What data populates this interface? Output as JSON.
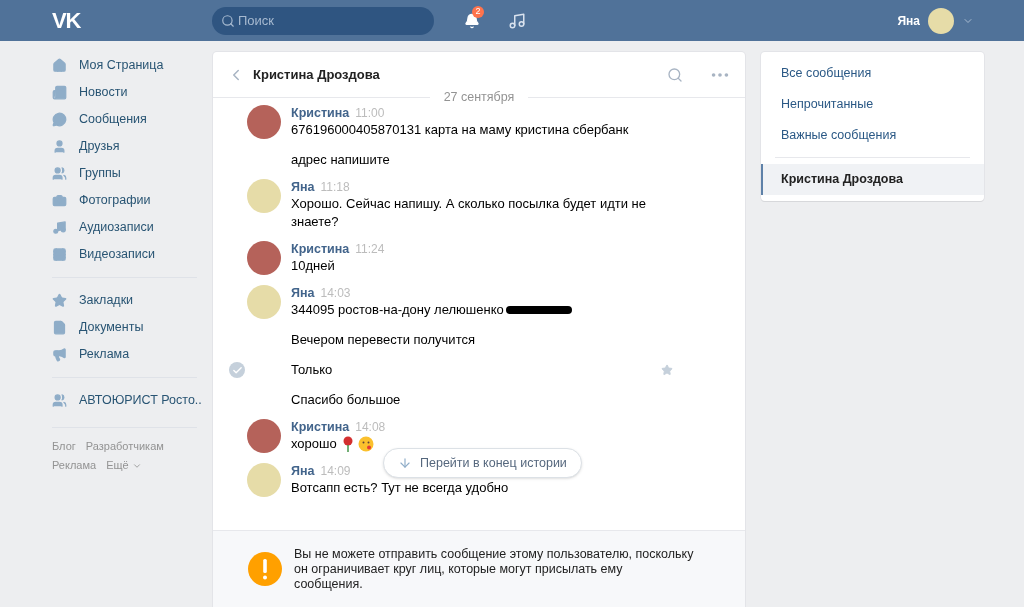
{
  "top_bar": {
    "logo": "VK",
    "search": {
      "placeholder": "Поиск"
    },
    "notifications": {
      "count": "2"
    },
    "user": {
      "name": "Яна"
    }
  },
  "sidebar": {
    "sections": [
      {
        "items": [
          {
            "label": "Моя Страница"
          },
          {
            "label": "Новости"
          },
          {
            "label": "Сообщения"
          },
          {
            "label": "Друзья"
          },
          {
            "label": "Группы"
          },
          {
            "label": "Фотографии"
          },
          {
            "label": "Аудиозаписи"
          },
          {
            "label": "Видеозаписи"
          }
        ]
      },
      {
        "items": [
          {
            "label": "Закладки"
          },
          {
            "label": "Документы"
          },
          {
            "label": "Реклама"
          }
        ]
      },
      {
        "items": [
          {
            "label": "АВТОЮРИСТ Росто.."
          }
        ]
      }
    ],
    "footer_links": [
      "Блог",
      "Разработчикам",
      "Реклама",
      "Ещё"
    ]
  },
  "chat": {
    "title": "Кристина Дроздова",
    "date": "27 сентября",
    "messages": [
      {
        "author": "Кристина",
        "time": "11:00",
        "kind": "contact",
        "lines": [
          {
            "text": "676196000405870131 карта на маму кристина сбербанк",
            "hovered": false,
            "kind": "plain"
          },
          {
            "text": "адрес напишите",
            "hovered": false,
            "kind": "plain"
          }
        ]
      },
      {
        "author": "Яна",
        "time": "11:18",
        "kind": "self",
        "lines": [
          {
            "text": "Хорошо. Сейчас напишу. А сколько посылка будет идти не знаете?",
            "hovered": false,
            "kind": "plain"
          }
        ]
      },
      {
        "author": "Кристина",
        "time": "11:24",
        "kind": "contact",
        "lines": [
          {
            "text": "10дней",
            "hovered": false,
            "kind": "plain"
          }
        ]
      },
      {
        "author": "Яна",
        "time": "14:03",
        "kind": "self",
        "lines": [
          {
            "text": "344095 ростов-на-дону лелюшенко",
            "hovered": false,
            "kind": "redacted"
          },
          {
            "text": "Вечером перевести получится",
            "hovered": false,
            "kind": "plain"
          },
          {
            "text": "Только",
            "hovered": true,
            "kind": "plain"
          },
          {
            "text": "Спасибо большое",
            "hovered": false,
            "kind": "plain"
          }
        ]
      },
      {
        "author": "Кристина",
        "time": "14:08",
        "kind": "contact",
        "lines": [
          {
            "text": "хорошо",
            "hovered": false,
            "kind": "emoji"
          }
        ]
      },
      {
        "author": "Яна",
        "time": "14:09",
        "kind": "self",
        "lines": [
          {
            "text": "Вотсапп есть? Тут не всегда удобно",
            "hovered": false,
            "kind": "plain"
          }
        ]
      }
    ],
    "jump_button": "Перейти в конец истории",
    "notice": "Вы не можете отправить сообщение этому пользователю, поскольку он ограничивает круг лиц, которые могут присылать ему сообщения."
  },
  "right_menu": {
    "items": [
      {
        "label": "Все сообщения",
        "selected": false,
        "kind": "filter"
      },
      {
        "label": "Непрочитанные",
        "selected": false,
        "kind": "filter"
      },
      {
        "label": "Важные сообщения",
        "selected": false,
        "kind": "filter"
      },
      {
        "label": "Кристина Дроздова",
        "selected": true,
        "kind": "conversation"
      }
    ]
  }
}
